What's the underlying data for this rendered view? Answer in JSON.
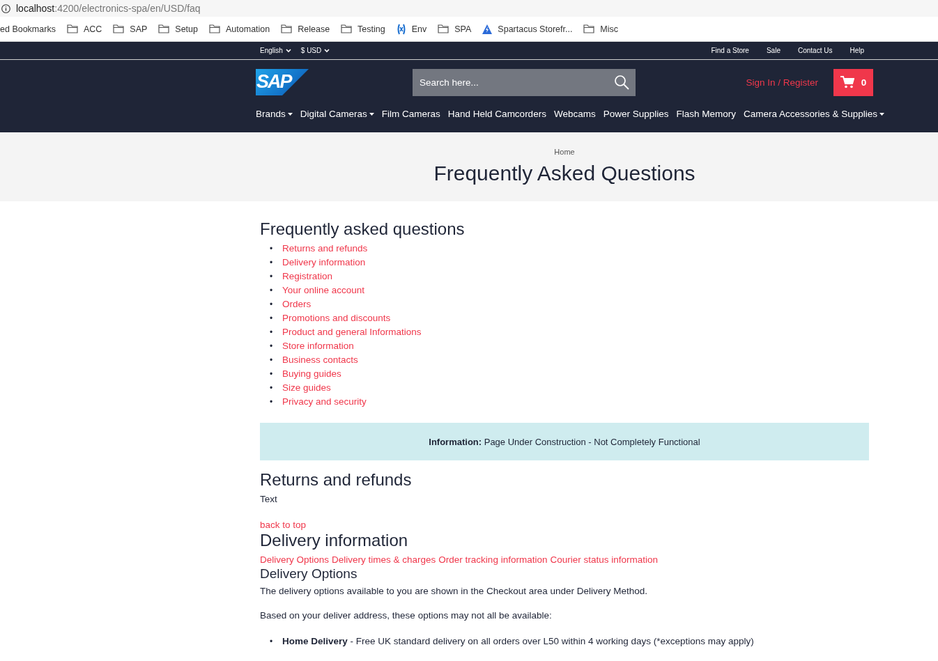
{
  "browser": {
    "url_host": "localhost",
    "url_path": ":4200/electronics-spa/en/USD/faq",
    "bookmarks": [
      {
        "label": "ed Bookmarks",
        "kind": "text"
      },
      {
        "label": "ACC",
        "kind": "folder"
      },
      {
        "label": "SAP",
        "kind": "folder"
      },
      {
        "label": "Setup",
        "kind": "folder"
      },
      {
        "label": "Automation",
        "kind": "folder"
      },
      {
        "label": "Release",
        "kind": "folder"
      },
      {
        "label": "Testing",
        "kind": "folder"
      },
      {
        "label": "Env",
        "kind": "bracket"
      },
      {
        "label": "SPA",
        "kind": "folder"
      },
      {
        "label": "Spartacus Storefr...",
        "kind": "bolt"
      },
      {
        "label": "Misc",
        "kind": "folder"
      }
    ]
  },
  "top_bar": {
    "language": "English",
    "currency": "$ USD",
    "links": [
      "Find a Store",
      "Sale",
      "Contact Us",
      "Help"
    ]
  },
  "header": {
    "logo": "SAP",
    "search": {
      "placeholder": "Search here..."
    },
    "sign_in": "Sign In / Register",
    "cart_count": "0"
  },
  "nav": [
    {
      "label": "Brands",
      "dropdown": true
    },
    {
      "label": "Digital Cameras",
      "dropdown": true
    },
    {
      "label": "Film Cameras",
      "dropdown": false
    },
    {
      "label": "Hand Held Camcorders",
      "dropdown": false
    },
    {
      "label": "Webcams",
      "dropdown": false
    },
    {
      "label": "Power Supplies",
      "dropdown": false
    },
    {
      "label": "Flash Memory",
      "dropdown": false
    },
    {
      "label": "Camera Accessories & Supplies",
      "dropdown": true
    }
  ],
  "breadcrumb": "Home",
  "page_title": "Frequently Asked Questions",
  "bullet_marker": "•",
  "faq": {
    "heading": "Frequently asked questions",
    "links": [
      "Returns and refunds",
      "Delivery information",
      "Registration",
      "Your online account",
      "Orders",
      "Promotions and discounts",
      "Product and general Informations",
      "Store information",
      "Business contacts",
      "Buying guides",
      "Size guides",
      "Privacy and security"
    ]
  },
  "notice": "**Information:** Page Under Construction - Not Completely Functional",
  "sections": [
    {
      "heading": "Returns and refunds",
      "text": "Text",
      "back_link": "back to top"
    },
    {
      "heading": "Delivery information",
      "links": [
        "Delivery Options",
        "Delivery times & charges",
        "Order tracking information",
        "Courier status information"
      ],
      "subheading": "Delivery Options",
      "paragraphs": [
        "The delivery options available to you are shown in the Checkout area under Delivery Method.",
        "Based on your deliver address, these options may not all be available:"
      ],
      "bullets": [
        "**Home Delivery** - Free UK standard delivery on all orders over L50 within 4 working days (*exceptions may apply)"
      ]
    }
  ]
}
